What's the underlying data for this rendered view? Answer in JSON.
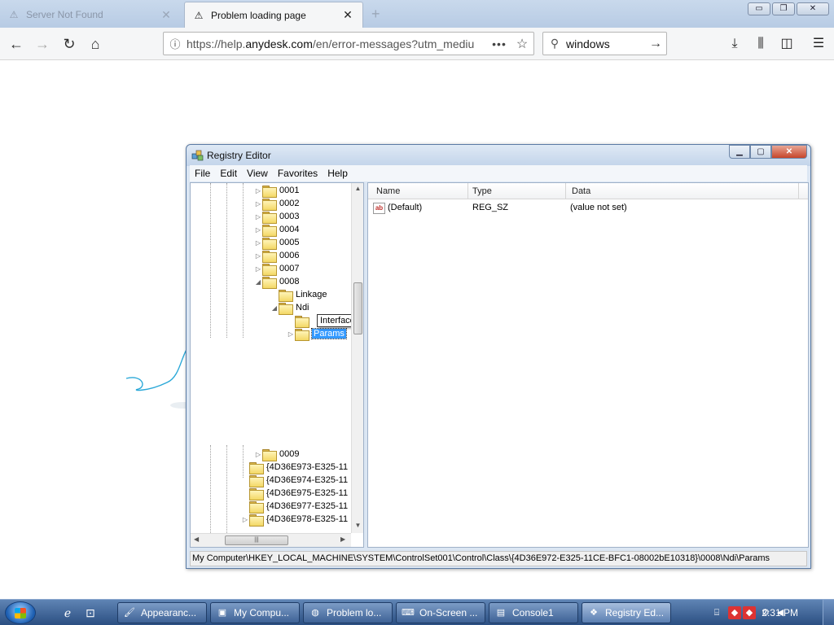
{
  "browser": {
    "tabs": [
      {
        "title": "Server Not Found",
        "icon": "warning-icon",
        "active": false
      },
      {
        "title": "Problem loading page",
        "icon": "warning-icon",
        "active": true
      }
    ],
    "window_controls": {
      "minimize": "▭",
      "restore": "❐",
      "close": "✕"
    },
    "url_host_prefix": "https://help.",
    "url_host": "anydesk.com",
    "url_path": "/en/error-messages?utm_mediu",
    "search_value": "windows",
    "new_tab": "+"
  },
  "regedit": {
    "title": "Registry Editor",
    "menu": [
      "File",
      "Edit",
      "View",
      "Favorites",
      "Help"
    ],
    "tree": [
      {
        "label": "0001",
        "expander": "▷"
      },
      {
        "label": "0002",
        "expander": "▷"
      },
      {
        "label": "0003",
        "expander": "▷"
      },
      {
        "label": "0004",
        "expander": "▷"
      },
      {
        "label": "0005",
        "expander": "▷"
      },
      {
        "label": "0006",
        "expander": "▷"
      },
      {
        "label": "0007",
        "expander": "▷"
      },
      {
        "label": "0008",
        "expander": "◢"
      },
      {
        "label": "Linkage",
        "expander": ""
      },
      {
        "label": "Ndi",
        "expander": "◢"
      },
      {
        "label": "",
        "expander": ""
      },
      {
        "label": "Params",
        "expander": "▷"
      },
      {
        "label": "0009",
        "expander": "▷"
      },
      {
        "label": "{4D36E973-E325-11",
        "expander": ""
      },
      {
        "label": "{4D36E974-E325-11",
        "expander": ""
      },
      {
        "label": "{4D36E975-E325-11",
        "expander": ""
      },
      {
        "label": "{4D36E977-E325-11",
        "expander": ""
      },
      {
        "label": "{4D36E978-E325-11",
        "expander": "▷"
      }
    ],
    "tooltip": "Interfaces",
    "columns": {
      "name": "Name",
      "type": "Type",
      "data": "Data"
    },
    "values": [
      {
        "name": "(Default)",
        "type": "REG_SZ",
        "data": "(value not set)",
        "icon": "ab"
      }
    ],
    "status_path": "My Computer\\HKEY_LOCAL_MACHINE\\SYSTEM\\ControlSet001\\Control\\Class\\{4D36E972-E325-11CE-BFC1-08002bE10318}\\0008\\Ndi\\Params"
  },
  "taskbar": {
    "buttons": [
      {
        "label": "Appearanc...",
        "icon": "appearance-icon"
      },
      {
        "label": "My Compu...",
        "icon": "computer-icon"
      },
      {
        "label": "Problem lo...",
        "icon": "firefox-icon"
      },
      {
        "label": "On-Screen ...",
        "icon": "keyboard-icon"
      },
      {
        "label": "Console1",
        "icon": "console-icon"
      },
      {
        "label": "Registry Ed...",
        "icon": "regedit-icon"
      }
    ],
    "clock": "2:31 PM"
  }
}
